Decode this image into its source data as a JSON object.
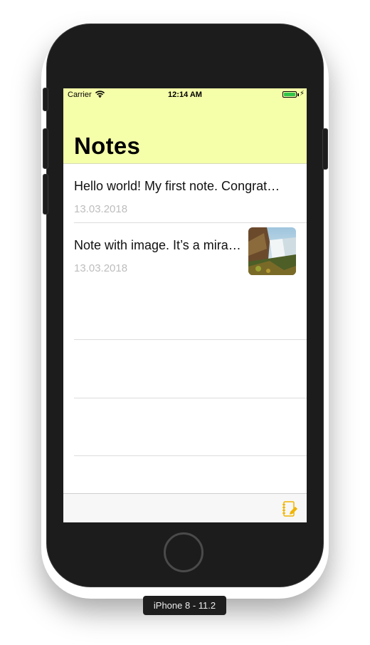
{
  "status_bar": {
    "carrier": "Carrier",
    "time": "12:14 AM",
    "battery_level": 1.0,
    "battery_color": "#33c74a"
  },
  "nav": {
    "title": "Notes",
    "background": "#f5fea8"
  },
  "notes": [
    {
      "title": "Hello world! My first note. Congrat…",
      "date": "13.03.2018",
      "has_image": false
    },
    {
      "title": "Note with image. It’s a mira…",
      "date": "13.03.2018",
      "has_image": true
    }
  ],
  "toolbar": {
    "compose_icon": "compose-note-icon",
    "accent": "#f0b400"
  },
  "device_label": "iPhone 8 - 11.2"
}
